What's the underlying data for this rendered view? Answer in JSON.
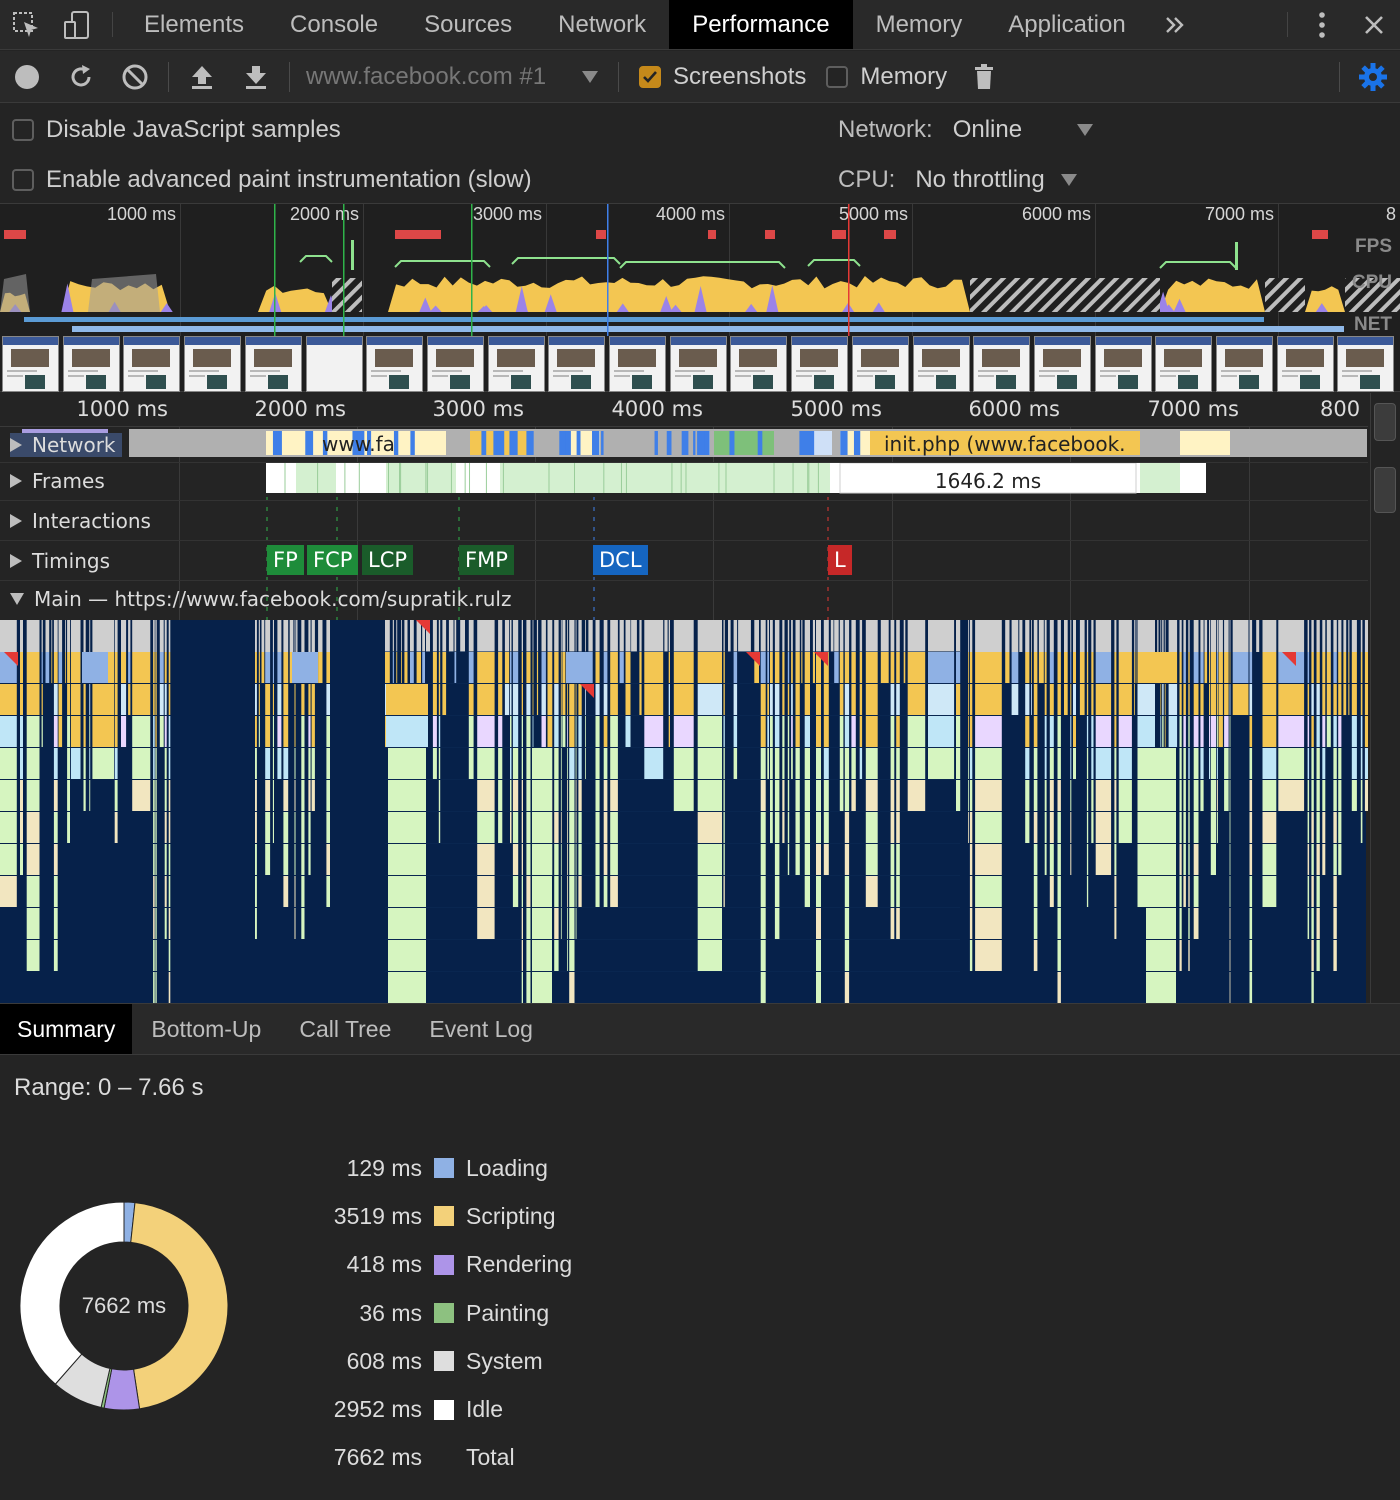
{
  "tabs": [
    {
      "label": "Elements"
    },
    {
      "label": "Console"
    },
    {
      "label": "Sources"
    },
    {
      "label": "Network"
    },
    {
      "label": "Performance"
    },
    {
      "label": "Memory"
    },
    {
      "label": "Application"
    }
  ],
  "active_tab": "Performance",
  "icons": {
    "inspect": "inspect-element-icon",
    "device": "device-toolbar-icon",
    "more_tabs": "chevron-double-right-icon",
    "kebab": "kebab-menu-icon",
    "close": "close-icon",
    "record": "record-icon",
    "reload": "reload-icon",
    "clear": "clear-icon",
    "upload": "upload-icon",
    "download": "download-icon",
    "trash": "trash-icon",
    "gear": "gear-icon"
  },
  "toolbar": {
    "profile": "www.facebook.com #1",
    "screenshots_label": "Screenshots",
    "screenshots_checked": true,
    "memory_label": "Memory",
    "memory_checked": false
  },
  "settings": {
    "disable_js_samples": "Disable JavaScript samples",
    "advanced_paint": "Enable advanced paint instrumentation (slow)",
    "network_label": "Network:",
    "network_value": "Online",
    "cpu_label": "CPU:",
    "cpu_value": "No throttling"
  },
  "overview": {
    "ticks": [
      "1000 ms",
      "2000 ms",
      "3000 ms",
      "4000 ms",
      "5000 ms",
      "6000 ms",
      "7000 ms",
      "8"
    ],
    "fps_label": "FPS",
    "cpu_label": "CPU",
    "net_label": "NET"
  },
  "flame": {
    "ticks": [
      "1000 ms",
      "2000 ms",
      "3000 ms",
      "4000 ms",
      "5000 ms",
      "6000 ms",
      "7000 ms",
      "800"
    ],
    "network_track": "Network",
    "network_req1": "www.fa",
    "network_req2": "init.php (www.facebook.",
    "frames_track": "Frames",
    "frame_time": "1646.2 ms",
    "interactions_track": "Interactions",
    "timings_track": "Timings",
    "main_track": "Main — https://www.facebook.com/supratik.rulz",
    "markers": [
      {
        "label": "FP",
        "color": "#1e8c3a"
      },
      {
        "label": "FCP",
        "color": "#1e8c3a"
      },
      {
        "label": "LCP",
        "color": "#1a5c2a"
      },
      {
        "label": "FMP",
        "color": "#1a5c2a"
      },
      {
        "label": "DCL",
        "color": "#1565c0"
      },
      {
        "label": "L",
        "color": "#c62828"
      }
    ]
  },
  "bottom_tabs": [
    {
      "label": "Summary"
    },
    {
      "label": "Bottom-Up"
    },
    {
      "label": "Call Tree"
    },
    {
      "label": "Event Log"
    }
  ],
  "summary": {
    "range": "Range: 0 – 7.66 s",
    "total_center": "7662 ms",
    "rows": [
      {
        "value": "129 ms",
        "label": "Loading",
        "color": "#8fb1e4"
      },
      {
        "value": "3519 ms",
        "label": "Scripting",
        "color": "#f3d17a"
      },
      {
        "value": "418 ms",
        "label": "Rendering",
        "color": "#ad94e8"
      },
      {
        "value": "36 ms",
        "label": "Painting",
        "color": "#8dc180"
      },
      {
        "value": "608 ms",
        "label": "System",
        "color": "#dedede"
      },
      {
        "value": "2952 ms",
        "label": "Idle",
        "color": "#ffffff"
      },
      {
        "value": "7662 ms",
        "label": "Total",
        "color": ""
      }
    ]
  }
}
